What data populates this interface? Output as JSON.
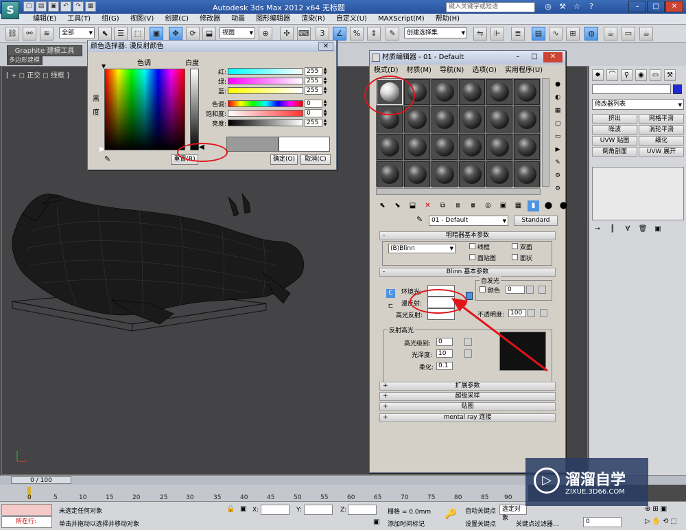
{
  "title_bar": {
    "app_title": "Autodesk 3ds Max  2012 x64      无标题",
    "search_placeholder": "键入关键字或短语"
  },
  "menu": [
    "编辑(E)",
    "工具(T)",
    "组(G)",
    "视图(V)",
    "创建(C)",
    "修改器",
    "动画",
    "图形编辑器",
    "渲染(R)",
    "自定义(U)",
    "MAXScript(M)",
    "帮助(H)"
  ],
  "toolbar": {
    "selection_filter": "全部",
    "ref_coord": "视图",
    "named_selection": "创建选择集"
  },
  "ribbon": {
    "tab": "Graphite 建模工具",
    "sub": "多边形建模"
  },
  "viewport": {
    "label": "[ + ◻ 正交 ◻ 线框 ]"
  },
  "color_dialog": {
    "title": "颜色选择器: 漫反射颜色",
    "hue_label": "色调",
    "whiteness_label": "白度",
    "blackness_label": "黑度",
    "rows": [
      {
        "label": "红:",
        "value": "255"
      },
      {
        "label": "绿:",
        "value": "255"
      },
      {
        "label": "蓝:",
        "value": "255"
      },
      {
        "label": "色调:",
        "value": "0"
      },
      {
        "label": "饱和度:",
        "value": "0"
      },
      {
        "label": "亮度:",
        "value": "255"
      }
    ],
    "reset": "重置(R)",
    "ok": "确定(O)",
    "cancel": "取消(C)"
  },
  "material_editor": {
    "title": "材质编辑器 - 01 - Default",
    "menu": [
      "模式(D)",
      "材质(M)",
      "导航(N)",
      "选项(O)",
      "实用程序(U)"
    ],
    "material_name": "01 - Default",
    "material_type": "Standard",
    "shader_rollout": "明暗器基本参数",
    "shader": "(B)Blinn",
    "wire": "线框",
    "two_sided": "双面",
    "face_map": "面贴图",
    "faceted": "面状",
    "blinn_rollout": "Blinn 基本参数",
    "self_illum": "自发光",
    "color_label": "颜色",
    "self_illum_value": "0",
    "ambient": "环境光:",
    "diffuse": "漫反射:",
    "specular": "高光反射:",
    "opacity_label": "不透明度:",
    "opacity": "100",
    "spec_group": "反射高光",
    "spec_level_label": "高光级别:",
    "spec_level": "0",
    "gloss_label": "光泽度:",
    "gloss": "10",
    "soften_label": "柔化:",
    "soften": "0.1",
    "rollouts": [
      "扩展参数",
      "超级采样",
      "贴图",
      "mental ray 连接"
    ]
  },
  "command_panel": {
    "modifier_list": "修改器列表",
    "buttons": [
      "挤出",
      "网格平滑",
      "噪波",
      "涡轮平滑",
      "UVW 贴图",
      "细化",
      "倒角剖面",
      "UVW 展开"
    ]
  },
  "timeline": {
    "slider": "0 / 100",
    "ticks": [
      "0",
      "5",
      "10",
      "15",
      "20",
      "25",
      "30",
      "35",
      "40",
      "45",
      "50",
      "55",
      "60",
      "65",
      "70",
      "75",
      "80",
      "85",
      "90"
    ]
  },
  "status": {
    "running": "所在行:",
    "none_selected": "未选定任何对象",
    "hint": "单击并拖动以选择并移动对象",
    "x": "X:",
    "y": "Y:",
    "z": "Z:",
    "grid": "栅格 = 0.0mm",
    "add_time_tag": "添加时间标记",
    "auto_key": "自动关键点",
    "set_key": "设置关键点",
    "selected": "选定对象",
    "key_filters": "关键点过滤器...",
    "frame": "0"
  },
  "watermark": {
    "brand": "溜溜自学",
    "url": "ZIXUE.3D66.COM"
  }
}
